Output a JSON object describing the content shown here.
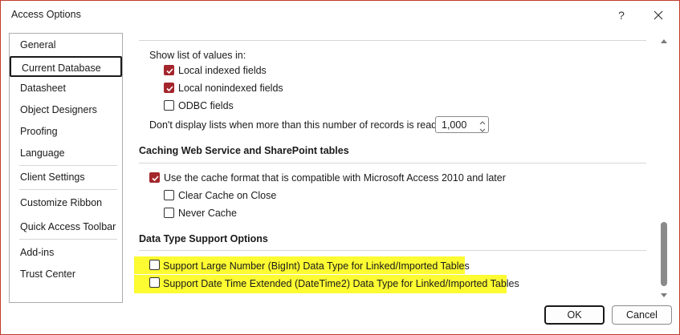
{
  "window": {
    "title": "Access Options",
    "help_label": "?"
  },
  "nav": {
    "items": [
      {
        "label": "General"
      },
      {
        "label": "Current Database",
        "selected": true
      },
      {
        "label": "Datasheet"
      },
      {
        "label": "Object Designers"
      },
      {
        "label": "Proofing"
      },
      {
        "label": "Language"
      },
      {
        "label": "Client Settings"
      },
      {
        "label": "Customize Ribbon"
      },
      {
        "label": "Quick Access Toolbar"
      },
      {
        "label": "Add-ins"
      },
      {
        "label": "Trust Center"
      }
    ]
  },
  "lookup": {
    "show_list_label": "Show list of values in:",
    "local_indexed": {
      "label": "Local indexed fields",
      "checked": true
    },
    "local_nonindexed": {
      "label": "Local nonindexed fields",
      "checked": true
    },
    "odbc": {
      "label": "ODBC fields",
      "checked": false
    },
    "records_limit_label": "Don't display lists when more than this number of records is read:",
    "records_limit_value": "1,000"
  },
  "caching": {
    "heading": "Caching Web Service and SharePoint tables",
    "cache_format": {
      "label": "Use the cache format that is compatible with Microsoft Access 2010 and later",
      "checked": true
    },
    "clear_cache": {
      "label": "Clear Cache on Close",
      "checked": false
    },
    "never_cache": {
      "label": "Never Cache",
      "checked": false
    }
  },
  "datatype": {
    "heading": "Data Type Support Options",
    "bigint": {
      "label": "Support Large Number (BigInt) Data Type for Linked/Imported Tables",
      "checked": false
    },
    "datetime2": {
      "label": "Support Date Time Extended (DateTime2) Data Type for Linked/Imported Tables",
      "checked": false
    }
  },
  "buttons": {
    "ok": "OK",
    "cancel": "Cancel"
  },
  "colors": {
    "checkbox_checked": "#a4262c",
    "highlight": "#fdfb31",
    "frame": "#c0392b"
  }
}
